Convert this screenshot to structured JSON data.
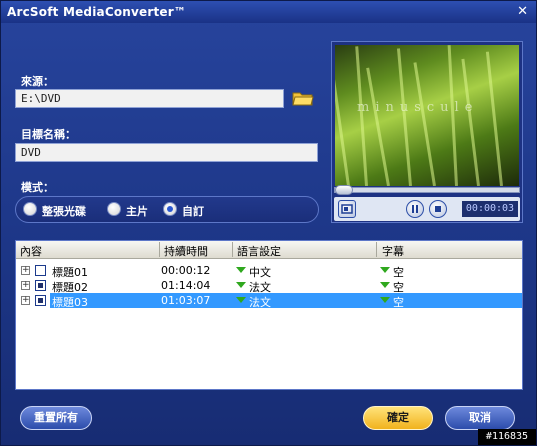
{
  "window": {
    "title": "ArcSoft MediaConverter™",
    "close_glyph": "✕"
  },
  "source": {
    "label": "來源：",
    "value": "E:\\DVD"
  },
  "target": {
    "label": "目標名稱：",
    "value": "DVD"
  },
  "mode": {
    "label": "模式：",
    "options": [
      "整張光碟",
      "主片",
      "自訂"
    ],
    "selected": "自訂"
  },
  "preview": {
    "overlay_text": "minuscule",
    "time": "00:00:03",
    "progress": 0.0
  },
  "table": {
    "headers": [
      "內容",
      "持續時間",
      "語言設定",
      "字幕"
    ],
    "rows": [
      {
        "title": "標題01",
        "duration": "00:00:12",
        "language": "中文",
        "subtitle": "空",
        "checked": false,
        "selected": false
      },
      {
        "title": "標題02",
        "duration": "01:14:04",
        "language": "法文",
        "subtitle": "空",
        "checked": true,
        "selected": false
      },
      {
        "title": "標題03",
        "duration": "01:03:07",
        "language": "法文",
        "subtitle": "空",
        "checked": true,
        "selected": true
      }
    ]
  },
  "buttons": {
    "reset": "重置所有",
    "ok": "確定",
    "cancel": "取消"
  },
  "watermark": "#116835",
  "colors": {
    "accent_blue": "#1c3585",
    "selection": "#3399ff",
    "ok_button": "#f1b21d",
    "dropdown_arrow": "#2fa81e"
  }
}
